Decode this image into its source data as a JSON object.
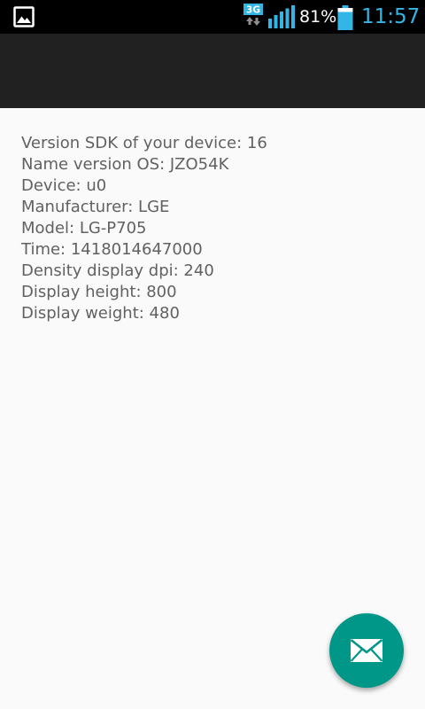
{
  "status_bar": {
    "network_type": "3G",
    "battery_percent": "81%",
    "time": "11:57",
    "icons": {
      "notification": "image-icon",
      "network": "3g-data-icon",
      "signal": "signal-strength-icon",
      "battery": "battery-icon"
    },
    "colors": {
      "background": "#000000",
      "clock": "#33b5e5",
      "network_badge": "#33b5e5"
    }
  },
  "app_bar": {
    "color": "#212121"
  },
  "device_info": [
    "Version SDK of your device: 16",
    "Name version OS: JZO54K",
    "Device: u0",
    "Manufacturer: LGE",
    "Model: LG-P705",
    "Time: 1418014647000",
    "Density display dpi: 240",
    "Display height: 800",
    "Display weight: 480"
  ],
  "fab": {
    "icon": "mail-icon",
    "color": "#009688"
  }
}
